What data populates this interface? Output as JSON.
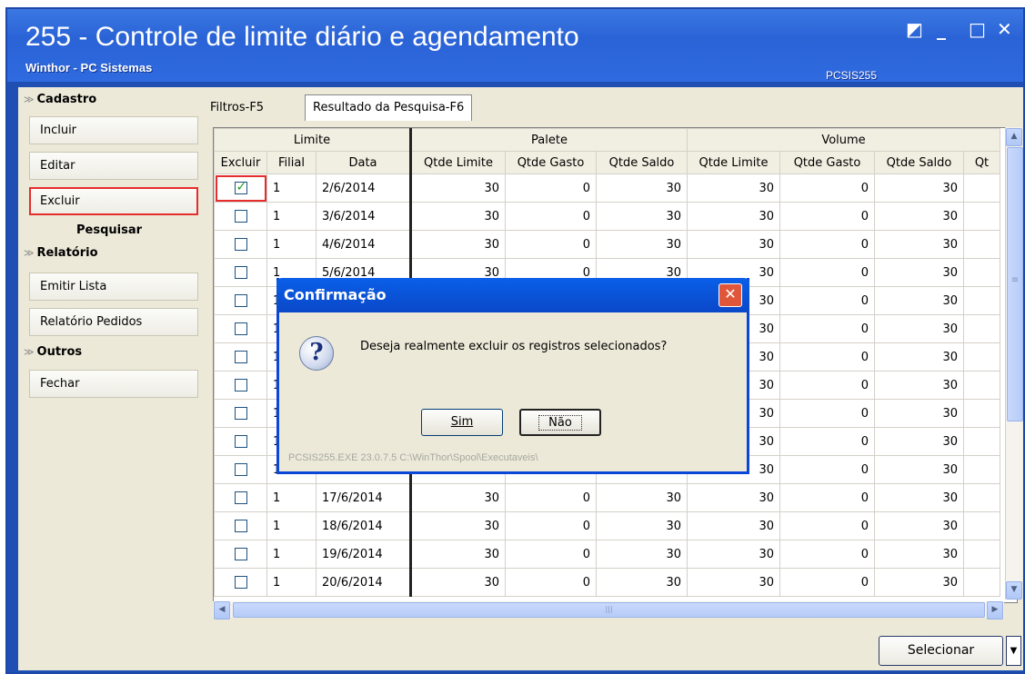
{
  "window": {
    "title": "255 - Controle de limite diário e agendamento",
    "subtitle": "Winthor - PC Sistemas",
    "code": "PCSIS255",
    "controls": {
      "restore": "◩",
      "minimize": "_",
      "maximize": "□",
      "close": "✕"
    }
  },
  "sidebar": {
    "cadastro_title": "Cadastro",
    "incluir": "Incluir",
    "editar": "Editar",
    "excluir": "Excluir",
    "pesquisar": "Pesquisar",
    "relatorio_title": "Relatório",
    "emitir_lista": "Emitir Lista",
    "relatorio_pedidos": "Relatório Pedidos",
    "outros_title": "Outros",
    "fechar": "Fechar",
    "chevron": "≫"
  },
  "tabs": {
    "filtros": "Filtros-F5",
    "resultado": "Resultado da Pesquisa-F6"
  },
  "grid": {
    "groups": {
      "limite": "Limite",
      "palete": "Palete",
      "volume": "Volume"
    },
    "columns": [
      "Excluir",
      "Filial",
      "Data",
      "Qtde Limite",
      "Qtde Gasto",
      "Qtde Saldo",
      "Qtde Limite",
      "Qtde Gasto",
      "Qtde Saldo",
      "Qt"
    ],
    "rows": [
      {
        "checked": true,
        "filial": "1",
        "data": "2/6/2014",
        "pl": "30",
        "pg": "0",
        "ps": "30",
        "vl": "30",
        "vg": "0",
        "vs": "30"
      },
      {
        "checked": false,
        "filial": "1",
        "data": "3/6/2014",
        "pl": "30",
        "pg": "0",
        "ps": "30",
        "vl": "30",
        "vg": "0",
        "vs": "30"
      },
      {
        "checked": false,
        "filial": "1",
        "data": "4/6/2014",
        "pl": "30",
        "pg": "0",
        "ps": "30",
        "vl": "30",
        "vg": "0",
        "vs": "30"
      },
      {
        "checked": false,
        "filial": "1",
        "data": "5/6/2014",
        "pl": "30",
        "pg": "0",
        "ps": "30",
        "vl": "30",
        "vg": "0",
        "vs": "30"
      },
      {
        "checked": false,
        "filial": "1",
        "data": "",
        "pl": "",
        "pg": "",
        "ps": "",
        "vl": "30",
        "vg": "0",
        "vs": "30"
      },
      {
        "checked": false,
        "filial": "1",
        "data": "",
        "pl": "",
        "pg": "",
        "ps": "",
        "vl": "30",
        "vg": "0",
        "vs": "30"
      },
      {
        "checked": false,
        "filial": "1",
        "data": "",
        "pl": "",
        "pg": "",
        "ps": "",
        "vl": "30",
        "vg": "0",
        "vs": "30"
      },
      {
        "checked": false,
        "filial": "1",
        "data": "",
        "pl": "",
        "pg": "",
        "ps": "",
        "vl": "30",
        "vg": "0",
        "vs": "30"
      },
      {
        "checked": false,
        "filial": "1",
        "data": "",
        "pl": "",
        "pg": "",
        "ps": "",
        "vl": "30",
        "vg": "0",
        "vs": "30"
      },
      {
        "checked": false,
        "filial": "1",
        "data": "",
        "pl": "",
        "pg": "",
        "ps": "",
        "vl": "30",
        "vg": "0",
        "vs": "30"
      },
      {
        "checked": false,
        "filial": "1",
        "data": "",
        "pl": "",
        "pg": "",
        "ps": "",
        "vl": "30",
        "vg": "0",
        "vs": "30"
      },
      {
        "checked": false,
        "filial": "1",
        "data": "17/6/2014",
        "pl": "30",
        "pg": "0",
        "ps": "30",
        "vl": "30",
        "vg": "0",
        "vs": "30"
      },
      {
        "checked": false,
        "filial": "1",
        "data": "18/6/2014",
        "pl": "30",
        "pg": "0",
        "ps": "30",
        "vl": "30",
        "vg": "0",
        "vs": "30"
      },
      {
        "checked": false,
        "filial": "1",
        "data": "19/6/2014",
        "pl": "30",
        "pg": "0",
        "ps": "30",
        "vl": "30",
        "vg": "0",
        "vs": "30"
      },
      {
        "checked": false,
        "filial": "1",
        "data": "20/6/2014",
        "pl": "30",
        "pg": "0",
        "ps": "30",
        "vl": "30",
        "vg": "0",
        "vs": "30"
      }
    ]
  },
  "footer": {
    "selecionar": "Selecionar",
    "arrow": "▼"
  },
  "dialog": {
    "title": "Confirmação",
    "close": "✕",
    "icon": "?",
    "message": "Deseja realmente excluir os registros selecionados?",
    "sim": "Sim",
    "nao": "Não",
    "footer": "PCSIS255.EXE 23.0.7.5 C:\\WinThor\\Spool\\Executaveis\\"
  },
  "scroll": {
    "up": "▲",
    "down": "▼",
    "left": "◀",
    "right": "▶",
    "grip": "≡",
    "hgrip": "|||"
  }
}
